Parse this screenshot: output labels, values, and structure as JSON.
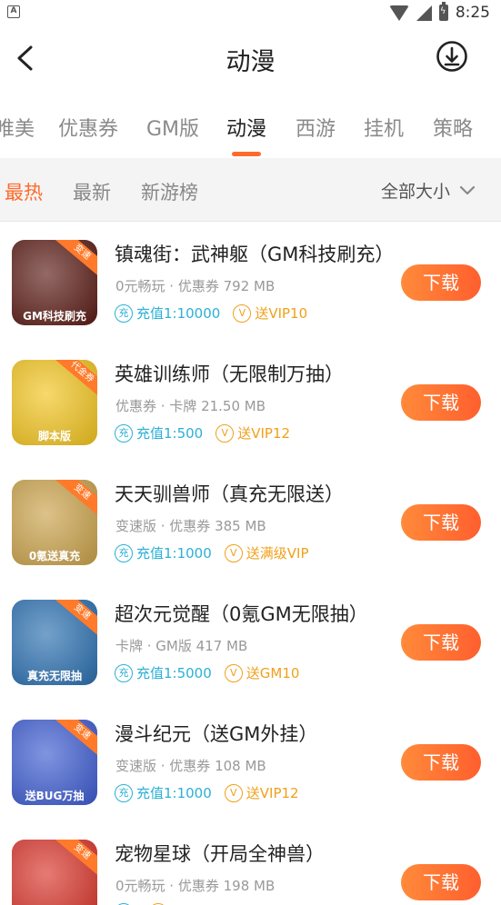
{
  "status_bar": {
    "time": "8:25",
    "left_icon": "A"
  },
  "header": {
    "title": "动漫"
  },
  "categories": [
    {
      "label": "唯美"
    },
    {
      "label": "优惠券"
    },
    {
      "label": "GM版"
    },
    {
      "label": "动漫"
    },
    {
      "label": "西游"
    },
    {
      "label": "挂机"
    },
    {
      "label": "策略"
    }
  ],
  "active_category": "动漫",
  "filters": [
    {
      "label": "最热"
    },
    {
      "label": "最新"
    },
    {
      "label": "新游榜"
    }
  ],
  "active_filter": "最热",
  "size_filter": {
    "label": "全部大小"
  },
  "download_label": "下载",
  "colors": {
    "accent": "#ff6a2b",
    "recharge": "#2bb0d6",
    "vip": "#f0a01a"
  },
  "games": [
    {
      "title": "镇魂街：武神躯（GM科技刷充）",
      "meta": "0元畅玩 · 优惠券  792 MB",
      "recharge_icon": "充",
      "recharge": "充值1:10000",
      "vip_icon": "V",
      "vip": "送VIP10",
      "badge": "变速",
      "icon_text": "GM科技刷充",
      "icon_bg": "#5a1a14"
    },
    {
      "title": "英雄训练师（无限制万抽）",
      "meta": "优惠券 · 卡牌  21.50 MB",
      "recharge_icon": "充",
      "recharge": "充值1:500",
      "vip_icon": "V",
      "vip": "送VIP12",
      "badge": "代金券",
      "icon_text": "脚本版",
      "icon_bg": "#f2c41e"
    },
    {
      "title": "天天驯兽师（真充无限送）",
      "meta": "变速版 · 优惠券  385 MB",
      "recharge_icon": "充",
      "recharge": "充值1:1000",
      "vip_icon": "V",
      "vip": "送满级VIP",
      "badge": "变速",
      "icon_text": "0氪送真充",
      "icon_bg": "#caa24a"
    },
    {
      "title": "超次元觉醒（0氪GM无限抽）",
      "meta": "卡牌 · GM版  417 MB",
      "recharge_icon": "充",
      "recharge": "充值1:5000",
      "vip_icon": "V",
      "vip": "送GM10",
      "badge": "变速",
      "icon_text": "真充无限抽",
      "icon_bg": "#2a6fb0"
    },
    {
      "title": "漫斗纪元（送GM外挂）",
      "meta": "变速版 · 优惠券  108 MB",
      "recharge_icon": "充",
      "recharge": "充值1:1000",
      "vip_icon": "V",
      "vip": "送VIP12",
      "badge": "变速",
      "icon_text": "送BUG万抽",
      "icon_bg": "#3c5bd0"
    },
    {
      "title": "宠物星球（开局全神兽）",
      "meta": "0元畅玩 · 优惠券  198 MB",
      "recharge_icon": "充",
      "recharge": "",
      "vip_icon": "V",
      "vip": "",
      "badge": "变速",
      "icon_text": "",
      "icon_bg": "#d8342a"
    }
  ]
}
